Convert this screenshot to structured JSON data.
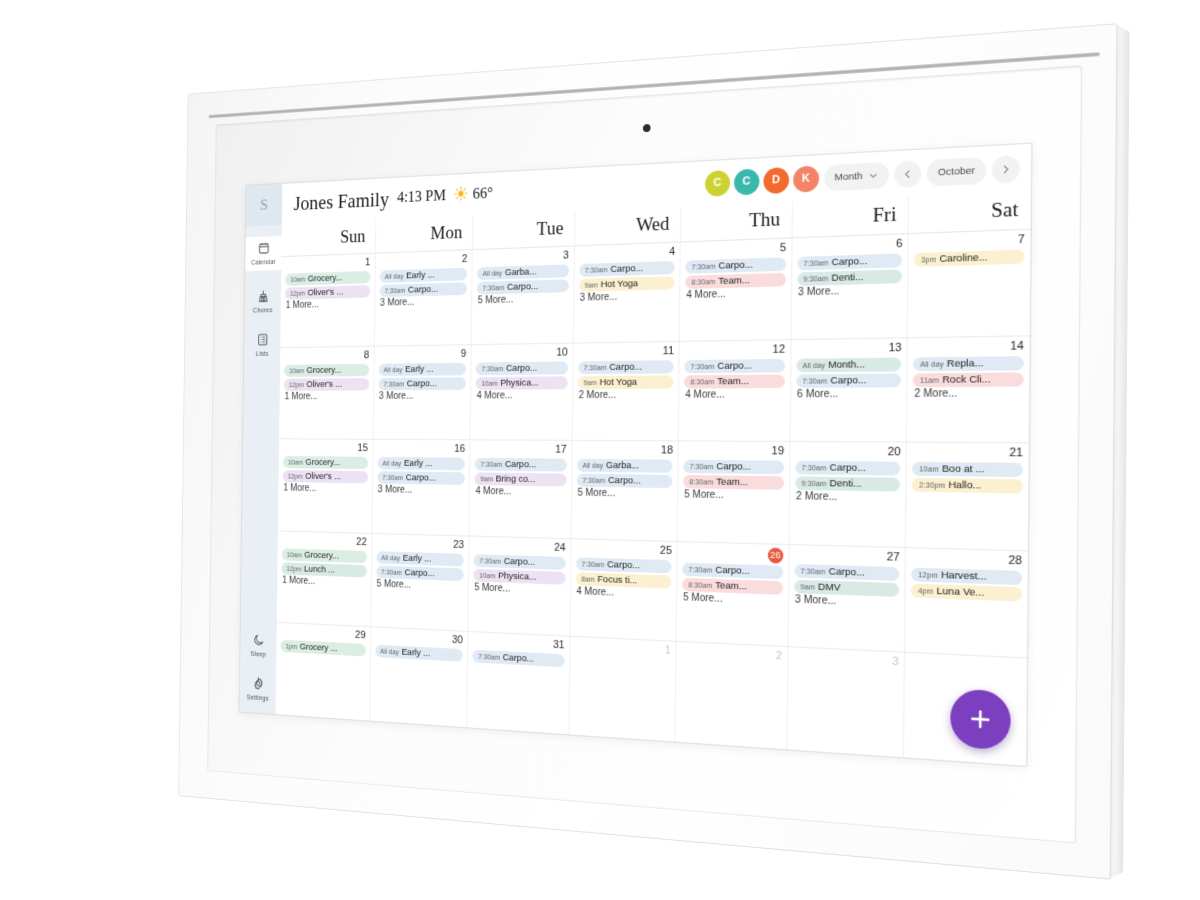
{
  "device": {
    "type": "wall-mounted-family-display"
  },
  "sidebar": {
    "logo": "S",
    "top_items": [
      {
        "label": "Calendar",
        "icon": "calendar-icon",
        "active": true
      },
      {
        "label": "Chores",
        "icon": "broom-icon",
        "active": false
      },
      {
        "label": "Lists",
        "icon": "list-icon",
        "active": false
      }
    ],
    "bottom_items": [
      {
        "label": "Sleep",
        "icon": "moon-icon",
        "active": false
      },
      {
        "label": "Settings",
        "icon": "gear-icon",
        "active": false
      }
    ]
  },
  "topbar": {
    "family_name": "Jones Family",
    "time": "4:13 PM",
    "weather_icon": "sun-icon",
    "temperature": "66°",
    "avatars": [
      {
        "initial": "C",
        "color": "#ccd330"
      },
      {
        "initial": "C",
        "color": "#3bb8ac"
      },
      {
        "initial": "D",
        "color": "#f26a2e"
      },
      {
        "initial": "K",
        "color": "#f58368"
      }
    ],
    "view_select": {
      "label": "Month",
      "icon": "chevron-down-icon"
    },
    "prev_label": "chevron-left-icon",
    "month_label": "October",
    "next_label": "chevron-right-icon"
  },
  "calendar": {
    "weekday_headers": [
      "Sun",
      "Mon",
      "Tue",
      "Wed",
      "Thu",
      "Fri",
      "Sat"
    ],
    "today": 26,
    "chip_colors": {
      "green": "#dceee4",
      "purple": "#ece2f3",
      "blue": "#dfeaf4",
      "yellow": "#fbf0cf",
      "pink": "#fadcdc",
      "teal": "#d9eae6"
    },
    "weeks": [
      [
        {
          "day": "1",
          "out": false,
          "events": [
            {
              "time": "10am",
              "title": "Grocery...",
              "color": "green"
            },
            {
              "time": "12pm",
              "title": "Oliver's ...",
              "color": "purple"
            }
          ],
          "more": "1 More..."
        },
        {
          "day": "2",
          "out": false,
          "events": [
            {
              "time": "All day",
              "title": "Early ...",
              "color": "blue"
            },
            {
              "time": "7:30am",
              "title": "Carpo...",
              "color": "blue"
            }
          ],
          "more": "3 More..."
        },
        {
          "day": "3",
          "out": false,
          "events": [
            {
              "time": "All day",
              "title": "Garba...",
              "color": "blue"
            },
            {
              "time": "7:30am",
              "title": "Carpo...",
              "color": "blue"
            }
          ],
          "more": "5 More..."
        },
        {
          "day": "4",
          "out": false,
          "events": [
            {
              "time": "7:30am",
              "title": "Carpo...",
              "color": "blue"
            },
            {
              "time": "9am",
              "title": "Hot Yoga",
              "color": "yellow"
            }
          ],
          "more": "3 More..."
        },
        {
          "day": "5",
          "out": false,
          "events": [
            {
              "time": "7:30am",
              "title": "Carpo...",
              "color": "blue"
            },
            {
              "time": "8:30am",
              "title": "Team...",
              "color": "pink"
            }
          ],
          "more": "4 More..."
        },
        {
          "day": "6",
          "out": false,
          "events": [
            {
              "time": "7:30am",
              "title": "Carpo...",
              "color": "blue"
            },
            {
              "time": "9:30am",
              "title": "Denti...",
              "color": "teal"
            }
          ],
          "more": "3 More..."
        },
        {
          "day": "7",
          "out": false,
          "events": [
            {
              "time": "3pm",
              "title": "Caroline...",
              "color": "yellow"
            }
          ],
          "more": ""
        }
      ],
      [
        {
          "day": "8",
          "out": false,
          "events": [
            {
              "time": "10am",
              "title": "Grocery...",
              "color": "green"
            },
            {
              "time": "12pm",
              "title": "Oliver's ...",
              "color": "purple"
            }
          ],
          "more": "1 More..."
        },
        {
          "day": "9",
          "out": false,
          "events": [
            {
              "time": "All day",
              "title": "Early ...",
              "color": "blue"
            },
            {
              "time": "7:30am",
              "title": "Carpo...",
              "color": "blue"
            }
          ],
          "more": "3 More..."
        },
        {
          "day": "10",
          "out": false,
          "events": [
            {
              "time": "7:30am",
              "title": "Carpo...",
              "color": "blue"
            },
            {
              "time": "10am",
              "title": "Physica...",
              "color": "purple"
            }
          ],
          "more": "4 More..."
        },
        {
          "day": "11",
          "out": false,
          "events": [
            {
              "time": "7:30am",
              "title": "Carpo...",
              "color": "blue"
            },
            {
              "time": "9am",
              "title": "Hot Yoga",
              "color": "yellow"
            }
          ],
          "more": "2 More..."
        },
        {
          "day": "12",
          "out": false,
          "events": [
            {
              "time": "7:30am",
              "title": "Carpo...",
              "color": "blue"
            },
            {
              "time": "8:30am",
              "title": "Team...",
              "color": "pink"
            }
          ],
          "more": "4 More..."
        },
        {
          "day": "13",
          "out": false,
          "events": [
            {
              "time": "All day",
              "title": "Month...",
              "color": "teal"
            },
            {
              "time": "7:30am",
              "title": "Carpo...",
              "color": "blue"
            }
          ],
          "more": "6 More..."
        },
        {
          "day": "14",
          "out": false,
          "events": [
            {
              "time": "All day",
              "title": "Repla...",
              "color": "blue"
            },
            {
              "time": "11am",
              "title": "Rock Cli...",
              "color": "pink"
            }
          ],
          "more": "2 More..."
        }
      ],
      [
        {
          "day": "15",
          "out": false,
          "events": [
            {
              "time": "10am",
              "title": "Grocery...",
              "color": "green"
            },
            {
              "time": "12pm",
              "title": "Oliver's ...",
              "color": "purple"
            }
          ],
          "more": "1 More..."
        },
        {
          "day": "16",
          "out": false,
          "events": [
            {
              "time": "All day",
              "title": "Early ...",
              "color": "blue"
            },
            {
              "time": "7:30am",
              "title": "Carpo...",
              "color": "blue"
            }
          ],
          "more": "3 More..."
        },
        {
          "day": "17",
          "out": false,
          "events": [
            {
              "time": "7:30am",
              "title": "Carpo...",
              "color": "blue"
            },
            {
              "time": "9am",
              "title": "Bring co...",
              "color": "purple"
            }
          ],
          "more": "4 More..."
        },
        {
          "day": "18",
          "out": false,
          "events": [
            {
              "time": "All day",
              "title": "Garba...",
              "color": "blue"
            },
            {
              "time": "7:30am",
              "title": "Carpo...",
              "color": "blue"
            }
          ],
          "more": "5 More..."
        },
        {
          "day": "19",
          "out": false,
          "events": [
            {
              "time": "7:30am",
              "title": "Carpo...",
              "color": "blue"
            },
            {
              "time": "8:30am",
              "title": "Team...",
              "color": "pink"
            }
          ],
          "more": "5 More..."
        },
        {
          "day": "20",
          "out": false,
          "events": [
            {
              "time": "7:30am",
              "title": "Carpo...",
              "color": "blue"
            },
            {
              "time": "9:30am",
              "title": "Denti...",
              "color": "teal"
            }
          ],
          "more": "2 More..."
        },
        {
          "day": "21",
          "out": false,
          "events": [
            {
              "time": "10am",
              "title": "Boo at ...",
              "color": "blue"
            },
            {
              "time": "2:30pm",
              "title": "Hallo...",
              "color": "yellow"
            }
          ],
          "more": ""
        }
      ],
      [
        {
          "day": "22",
          "out": false,
          "events": [
            {
              "time": "10am",
              "title": "Grocery...",
              "color": "green"
            },
            {
              "time": "12pm",
              "title": "Lunch ...",
              "color": "teal"
            }
          ],
          "more": "1 More..."
        },
        {
          "day": "23",
          "out": false,
          "events": [
            {
              "time": "All day",
              "title": "Early ...",
              "color": "blue"
            },
            {
              "time": "7:30am",
              "title": "Carpo...",
              "color": "blue"
            }
          ],
          "more": "5 More..."
        },
        {
          "day": "24",
          "out": false,
          "events": [
            {
              "time": "7:30am",
              "title": "Carpo...",
              "color": "blue"
            },
            {
              "time": "10am",
              "title": "Physica...",
              "color": "purple"
            }
          ],
          "more": "5 More..."
        },
        {
          "day": "25",
          "out": false,
          "events": [
            {
              "time": "7:30am",
              "title": "Carpo...",
              "color": "blue"
            },
            {
              "time": "8am",
              "title": "Focus ti...",
              "color": "yellow"
            }
          ],
          "more": "4 More..."
        },
        {
          "day": "26",
          "out": false,
          "today": true,
          "events": [
            {
              "time": "7:30am",
              "title": "Carpo...",
              "color": "blue"
            },
            {
              "time": "8:30am",
              "title": "Team...",
              "color": "pink"
            }
          ],
          "more": "5 More..."
        },
        {
          "day": "27",
          "out": false,
          "events": [
            {
              "time": "7:30am",
              "title": "Carpo...",
              "color": "blue"
            },
            {
              "time": "9am",
              "title": "DMV",
              "color": "teal"
            }
          ],
          "more": "3 More..."
        },
        {
          "day": "28",
          "out": false,
          "events": [
            {
              "time": "12pm",
              "title": "Harvest...",
              "color": "blue"
            },
            {
              "time": "4pm",
              "title": "Luna Ve...",
              "color": "yellow"
            }
          ],
          "more": ""
        }
      ],
      [
        {
          "day": "29",
          "out": false,
          "events": [
            {
              "time": "1pm",
              "title": "Grocery ...",
              "color": "green"
            }
          ],
          "more": ""
        },
        {
          "day": "30",
          "out": false,
          "events": [
            {
              "time": "All day",
              "title": "Early ...",
              "color": "blue"
            }
          ],
          "more": ""
        },
        {
          "day": "31",
          "out": false,
          "events": [
            {
              "time": "7:30am",
              "title": "Carpo...",
              "color": "blue"
            }
          ],
          "more": ""
        },
        {
          "day": "1",
          "out": true,
          "events": [],
          "more": ""
        },
        {
          "day": "2",
          "out": true,
          "events": [],
          "more": ""
        },
        {
          "day": "3",
          "out": true,
          "events": [],
          "more": ""
        },
        {
          "day": "",
          "out": true,
          "events": [],
          "more": ""
        }
      ]
    ]
  },
  "fab": {
    "label": "add-event",
    "icon": "plus-icon",
    "color": "#7b3fbf"
  }
}
